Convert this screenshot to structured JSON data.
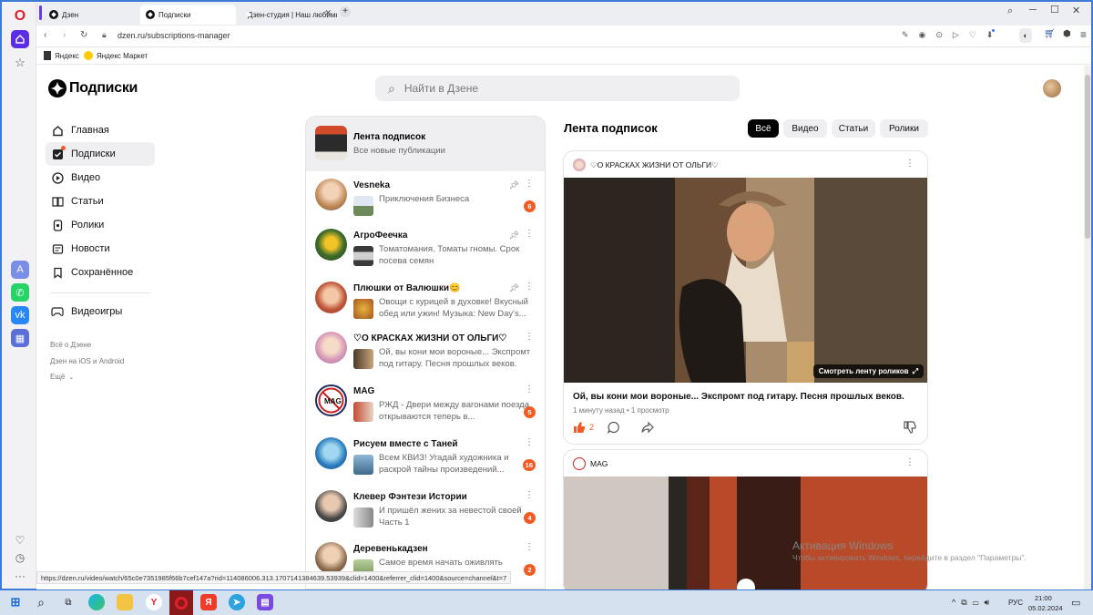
{
  "tabs": [
    {
      "title": "Дзен"
    },
    {
      "title": "Подписки"
    },
    {
      "title": "Дзен-студия | Наш любимый"
    }
  ],
  "address": {
    "url": "dzen.ru/subscriptions-manager"
  },
  "bookmarks": [
    {
      "label": "Яндекс"
    },
    {
      "label": "Яндекс Маркет"
    }
  ],
  "header": {
    "logo_text": "Подписки",
    "search_placeholder": "Найти в Дзене"
  },
  "sidebar": {
    "items": [
      {
        "label": "Главная",
        "icon": "home-icon"
      },
      {
        "label": "Подписки",
        "icon": "subscriptions-icon"
      },
      {
        "label": "Видео",
        "icon": "video-icon"
      },
      {
        "label": "Статьи",
        "icon": "articles-icon"
      },
      {
        "label": "Ролики",
        "icon": "shorts-icon"
      },
      {
        "label": "Новости",
        "icon": "news-icon"
      },
      {
        "label": "Сохранённое",
        "icon": "bookmark-icon"
      }
    ],
    "games": {
      "label": "Видеоигры"
    },
    "links": [
      "Всё о Дзене",
      "Дзен на iOS и Android",
      "Ещё"
    ]
  },
  "feed_header": {
    "title": "Лента подписок",
    "subtitle": "Все новые публикации"
  },
  "subscriptions": [
    {
      "name": "Vesneka",
      "text": "Приключения Бизнеса",
      "badge": "6",
      "pinned": true
    },
    {
      "name": "АгроФеечка",
      "text": "Томатомания. Томаты гномы. Срок посева семян",
      "badge": "",
      "pinned": true
    },
    {
      "name": "Плюшки от Валюшки😊",
      "text": "Овощи с курицей в духовке! Вкусный обед или ужин! Музыка: New Day's...",
      "badge": "",
      "pinned": true
    },
    {
      "name": "♡О КРАСКАХ ЖИЗНИ ОТ ОЛЬГИ♡",
      "text": "Ой, вы кони мои вороные... Экспромт под гитару. Песня прошлых веков.",
      "badge": "",
      "pinned": false
    },
    {
      "name": "MAG",
      "text": "РЖД - Двери между вагонами поезда открываются теперь в...",
      "badge": "5",
      "pinned": false
    },
    {
      "name": "Рисуем вместе с Таней",
      "text": "Всем КВИЗ! Угадай художника и раскрой тайны произведений...",
      "badge": "16",
      "pinned": false
    },
    {
      "name": "Клевер Фэнтези Истории",
      "text": "И пришёл жених за невестой своей Часть 1",
      "badge": "4",
      "pinned": false
    },
    {
      "name": "Деревенькадзен",
      "text": "Самое время начать оживлять",
      "badge": "2",
      "pinned": false
    }
  ],
  "feed": {
    "title": "Лента подписок",
    "filters": [
      "Всё",
      "Видео",
      "Статьи",
      "Ролики"
    ],
    "active_filter": "Всё"
  },
  "post1": {
    "channel": "♡О КРАСКАХ ЖИЗНИ ОТ ОЛЬГИ♡",
    "overlay_button": "Смотреть ленту роликов",
    "title": "Ой, вы кони мои вороные... Экспромт под гитару. Песня прошлых веков.",
    "meta": "1 минуту назад • 1 просмотр",
    "likes": "2"
  },
  "post2": {
    "channel": "MAG"
  },
  "watermark": {
    "line1": "Активация Windows",
    "line2": "Чтобы активировать Windows, перейдите в раздел \"Параметры\"."
  },
  "status_url": "https://dzen.ru/video/watch/65c0e7351985f66b7cef147a?rid=114086006.313.1707141384639.53939&clid=1400&referrer_clid=1400&source=channel&t=7",
  "taskbar": {
    "lang": "РУС",
    "time": "21:00",
    "date": "05.02.2024"
  },
  "colors": {
    "accent": "#f25b23",
    "opera_red": "#e0212b",
    "sidebar_active": "#efeff2"
  }
}
